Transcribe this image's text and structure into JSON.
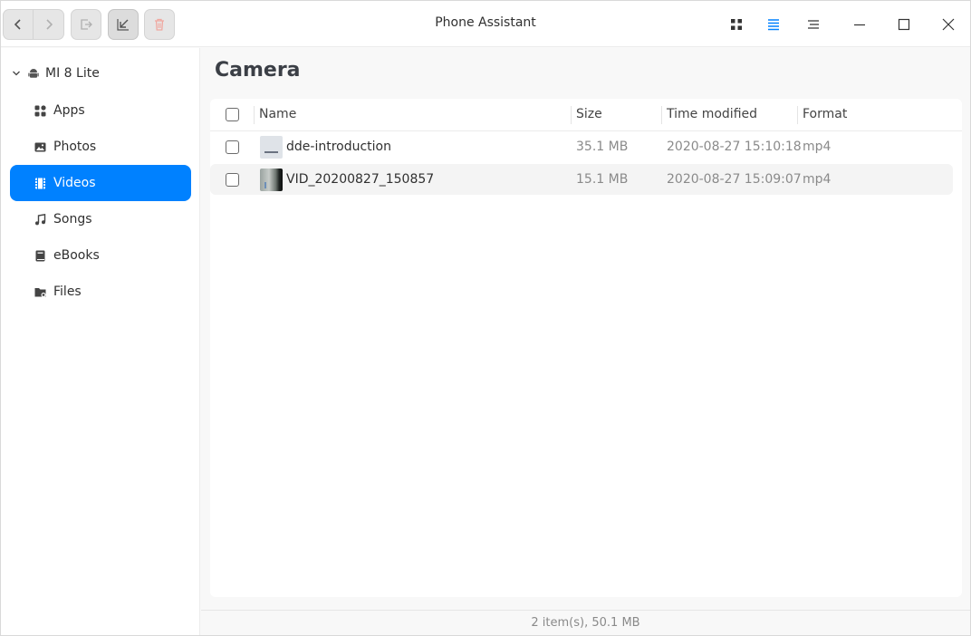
{
  "window": {
    "title": "Phone Assistant"
  },
  "toolbar": {
    "back_icon": "chevron-left-icon",
    "forward_icon": "chevron-right-icon",
    "export_icon": "export-icon",
    "import_icon": "import-icon",
    "delete_icon": "trash-icon",
    "delete_color": "#f0a8a0",
    "views": [
      "icon-view",
      "list-view",
      "details-view"
    ],
    "active_view": "list-view",
    "accent": "#0081ff"
  },
  "sidebar": {
    "device": "MI 8 Lite",
    "items": [
      {
        "label": "Apps",
        "icon": "apps-icon"
      },
      {
        "label": "Photos",
        "icon": "photo-icon"
      },
      {
        "label": "Videos",
        "icon": "video-icon",
        "active": true
      },
      {
        "label": "Songs",
        "icon": "music-note-icon"
      },
      {
        "label": "eBooks",
        "icon": "book-icon"
      },
      {
        "label": "Files",
        "icon": "folder-icon"
      }
    ]
  },
  "main": {
    "title": "Camera",
    "columns": {
      "name": "Name",
      "size": "Size",
      "time": "Time modified",
      "format": "Format"
    },
    "rows": [
      {
        "name": "dde-introduction",
        "size": "35.1 MB",
        "time": "2020-08-27 15:10:18",
        "format": "mp4"
      },
      {
        "name": "VID_20200827_150857",
        "size": "15.1 MB",
        "time": "2020-08-27 15:09:07",
        "format": "mp4"
      }
    ]
  },
  "status": {
    "text": "2 item(s), 50.1 MB"
  }
}
